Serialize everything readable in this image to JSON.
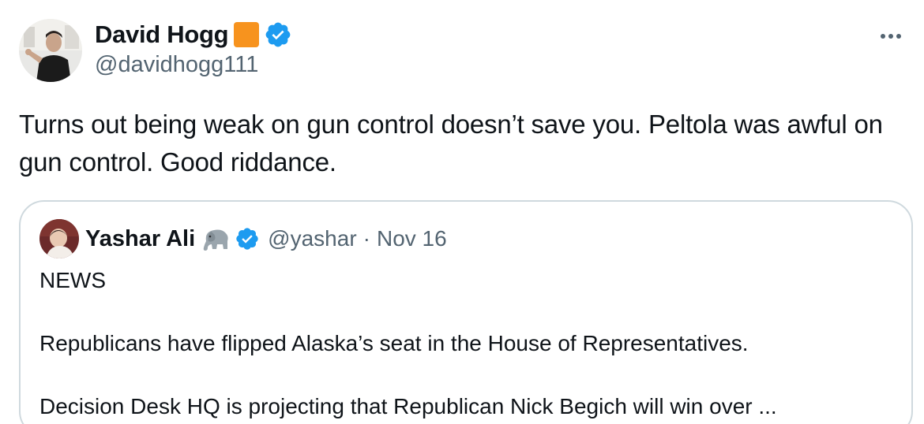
{
  "author": {
    "name": "David Hogg",
    "handle": "@davidhogg111",
    "badge_color": "#f7931e",
    "verified_color": "#1d9bf0"
  },
  "more_icon": "more-horizontal-icon",
  "tweet": {
    "text": "Turns out being weak on gun control doesn’t save you. Peltola was awful on gun control. Good riddance."
  },
  "quoted": {
    "name": "Yashar Ali",
    "emoji_icon": "elephant-icon",
    "handle": "@yashar",
    "separator": "·",
    "date": "Nov 16",
    "body": [
      "NEWS",
      "",
      "Republicans have flipped Alaska’s seat in the House of Representatives.",
      "",
      "Decision Desk HQ is projecting that Republican Nick Begich will win over ..."
    ]
  }
}
